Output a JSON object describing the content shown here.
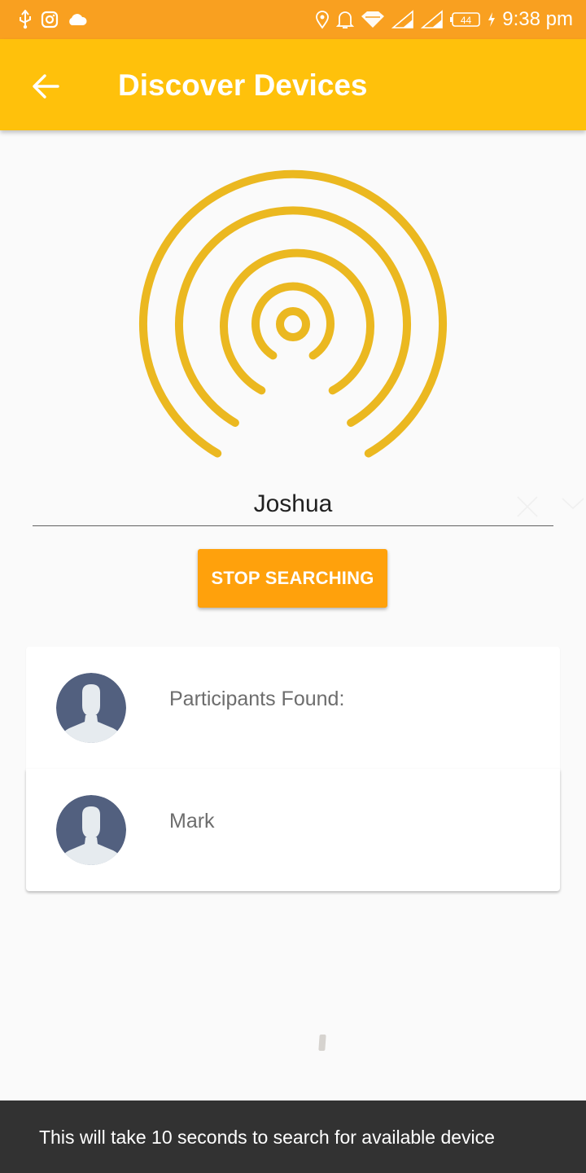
{
  "status_bar": {
    "time": "9:38 pm",
    "battery_level": "44",
    "left_icons": [
      "usb-icon",
      "instagram-icon",
      "cloud-icon"
    ],
    "right_icons": [
      "location-icon",
      "bell-icon",
      "wifi-icon",
      "signal-icon",
      "signal-icon",
      "battery-icon",
      "charging-icon"
    ]
  },
  "app_bar": {
    "title": "Discover Devices",
    "back_icon": "arrow-back-icon",
    "color": "#ffc10b"
  },
  "radar": {
    "icon": "broadcast-radar-icon",
    "color": "#ebb820"
  },
  "name_field": {
    "value": "Joshua",
    "clear_icon": "close-icon",
    "dropdown_icon": "chevron-down-icon"
  },
  "stop_button": {
    "label": "STOP SEARCHING",
    "color": "#ffa10c"
  },
  "participants": {
    "header": "Participants Found:",
    "items": [
      {
        "name": "Mark",
        "icon": "avatar-icon"
      }
    ]
  },
  "snackbar": {
    "message": "This will take 10 seconds to search for available device"
  }
}
